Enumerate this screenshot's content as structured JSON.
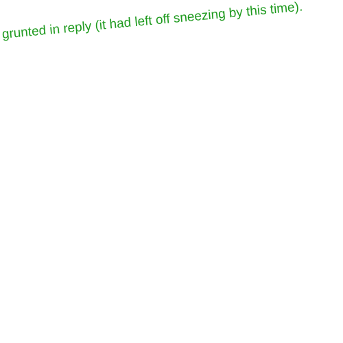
{
  "text": {
    "line": "grunted in reply (it had left off sneezing by this time).",
    "color": "#1e9a1e"
  }
}
